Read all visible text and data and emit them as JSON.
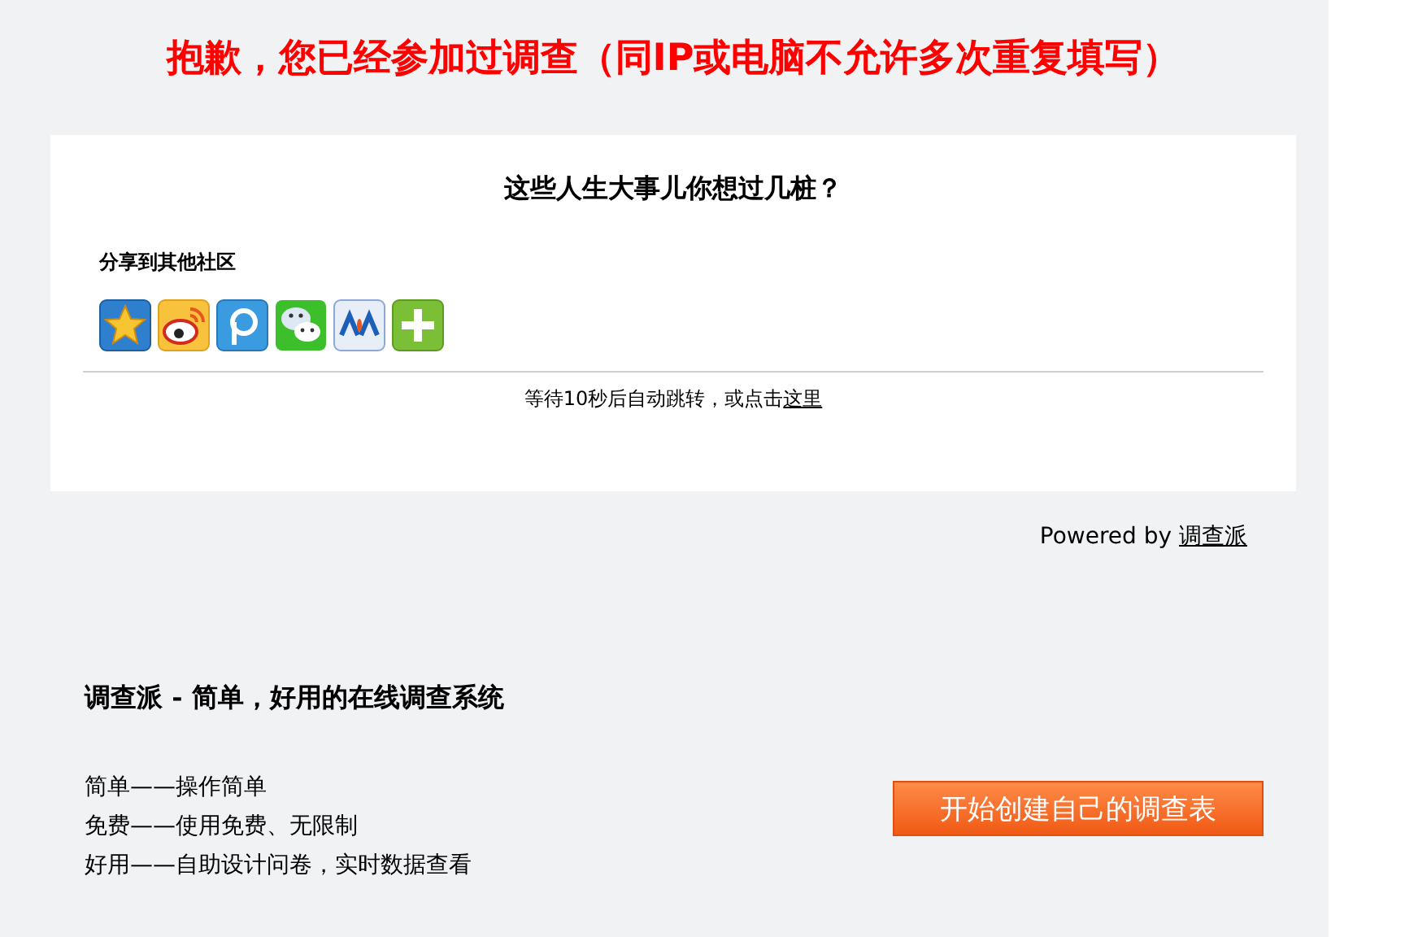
{
  "notice": {
    "before": "抱歉，您已经参加过调查（同",
    "bold": "IP",
    "after": "或电脑不允许多次重复填写）"
  },
  "card": {
    "title": "这些人生大事儿你想过几桩？",
    "share_label": "分享到其他社区",
    "redirect_text": "等待10秒后自动跳转，或点击",
    "redirect_link": "这里"
  },
  "powered": {
    "text": "Powered by",
    "link": "调查派"
  },
  "promo": {
    "heading": "调查派 - 简单，好用的在线调查系统",
    "features": [
      "简单——操作简单",
      "免费——使用免费、无限制",
      "好用——自助设计问卷，实时数据查看"
    ],
    "button": "开始创建自己的调查表"
  }
}
